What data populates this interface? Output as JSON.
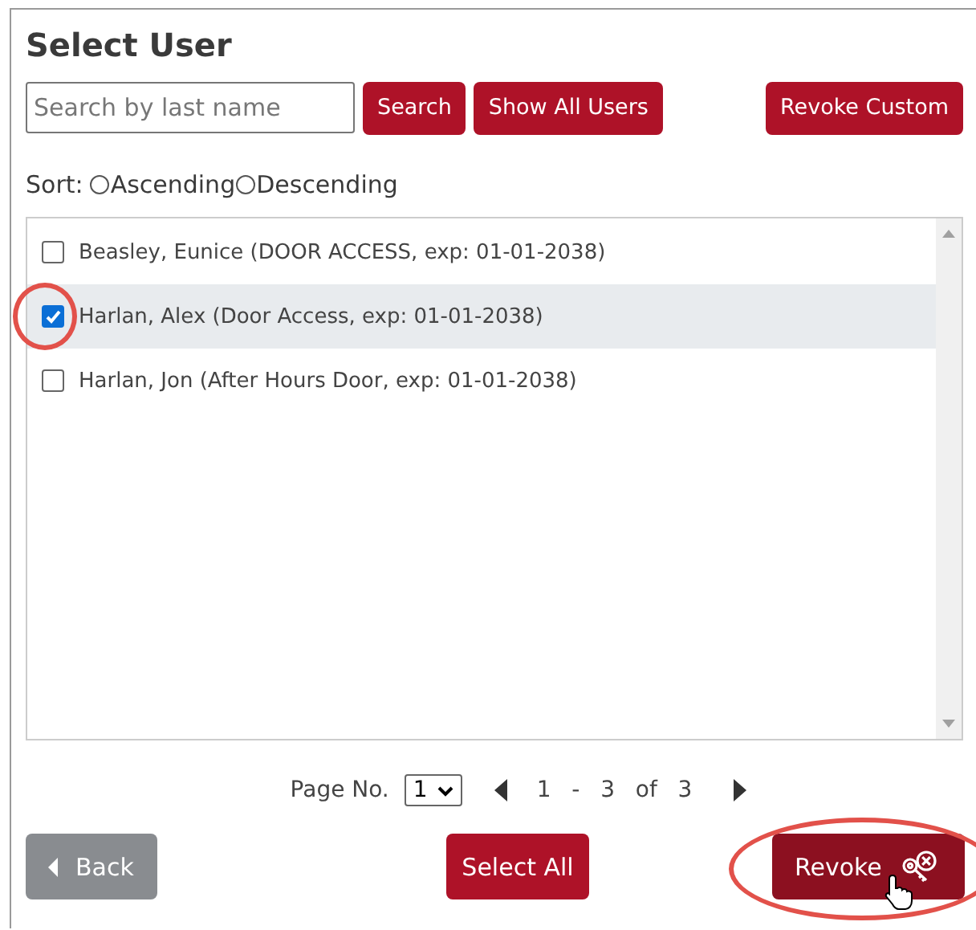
{
  "title": "Select User",
  "search": {
    "placeholder": "Search by last name"
  },
  "toolbar_buttons": [
    {
      "label": "Search",
      "kind": "left"
    },
    {
      "label": "Show All Users",
      "kind": "left"
    },
    {
      "label": "Revoke Custom",
      "kind": "right"
    }
  ],
  "sort": {
    "label": "Sort:",
    "options": [
      {
        "label": "Ascending",
        "selected": false
      },
      {
        "label": "Descending",
        "selected": false
      }
    ]
  },
  "users": [
    {
      "label": "Beasley, Eunice (DOOR ACCESS, exp: 01-01-2038)",
      "checked": false,
      "selected": false,
      "circled": false
    },
    {
      "label": "Harlan, Alex (Door Access, exp: 01-01-2038)",
      "checked": true,
      "selected": true,
      "circled": true
    },
    {
      "label": "Harlan, Jon (After Hours Door, exp: 01-01-2038)",
      "checked": false,
      "selected": false,
      "circled": false
    }
  ],
  "pager": {
    "label": "Page No.",
    "page": "1",
    "range": "1  -  3  of  3"
  },
  "back": {
    "label": "Back"
  },
  "select_all": {
    "label": "Select All"
  },
  "revoke": {
    "label": "Revoke",
    "hover": true,
    "circled": true
  }
}
